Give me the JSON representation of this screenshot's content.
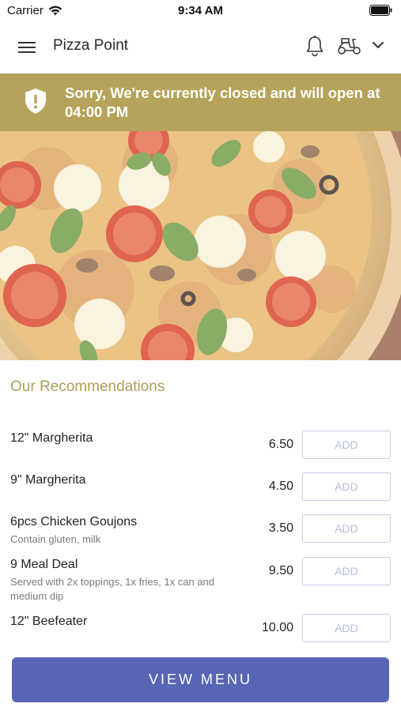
{
  "status_bar": {
    "carrier": "Carrier",
    "time": "9:34 AM"
  },
  "header": {
    "title": "Pizza Point",
    "icons": [
      "hamburger-menu-icon",
      "bell-icon",
      "scooter-icon",
      "chevron-down-icon"
    ]
  },
  "banner": {
    "message": "Sorry, We're currently closed and will open at 04:00 PM",
    "color": "#b5a35b"
  },
  "recommendations": {
    "title": "Our Recommendations",
    "items": [
      {
        "name": "12\" Margherita",
        "description": "",
        "price": "6.50",
        "button": "ADD"
      },
      {
        "name": "9\" Margherita",
        "description": "",
        "price": "4.50",
        "button": "ADD"
      },
      {
        "name": "6pcs Chicken Goujons",
        "description": "Contain gluten, milk",
        "price": "3.50",
        "button": "ADD"
      },
      {
        "name": "9 Meal Deal",
        "description": "Served with 2x toppings, 1x fries, 1x can and medium dip",
        "price": "9.50",
        "button": "ADD"
      },
      {
        "name": "12\" Beefeater",
        "description": "",
        "price": "10.00",
        "button": "ADD"
      }
    ]
  },
  "footer": {
    "view_menu_label": "VIEW MENU",
    "accent_color": "#5865b5"
  }
}
